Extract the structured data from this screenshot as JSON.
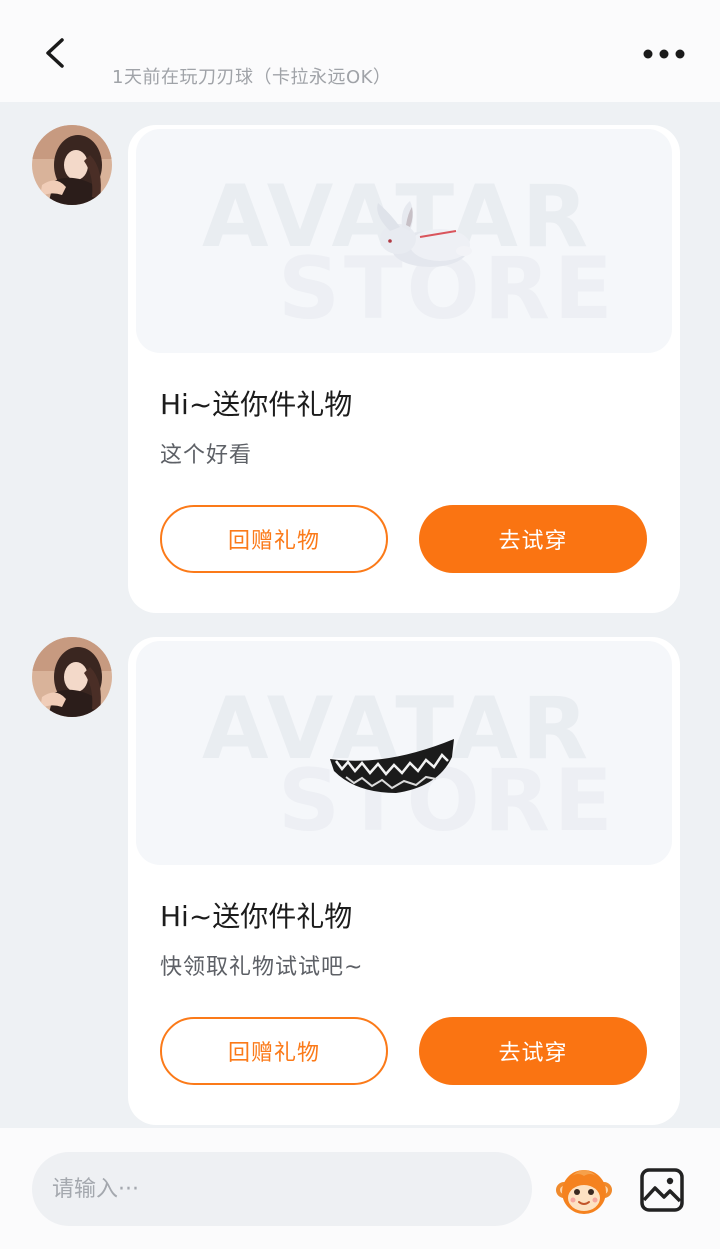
{
  "header": {
    "subtitle": "1天前在玩刀刃球（卡拉永远OK）",
    "back_icon": "chevron-left-icon",
    "more_icon": "more-dots-icon"
  },
  "messages": [
    {
      "title": "Hi~送你件礼物",
      "text": "这个好看",
      "item": "rabbit-plush",
      "watermark_top": "AVATAR",
      "watermark_bottom": "STORE",
      "return_gift_label": "回赠礼物",
      "try_on_label": "去试穿"
    },
    {
      "title": "Hi~送你件礼物",
      "text": "快领取礼物试试吧~",
      "item": "monster-teeth",
      "watermark_top": "AVATAR",
      "watermark_bottom": "STORE",
      "return_gift_label": "回赠礼物",
      "try_on_label": "去试穿"
    }
  ],
  "composer": {
    "placeholder": "请输入···",
    "emoji_icon": "monkey-emoji-icon",
    "image_icon": "image-icon"
  },
  "colors": {
    "accent": "#fa7412",
    "background": "#eef1f4",
    "card": "#ffffff",
    "subtitle": "#a0a3a8"
  }
}
